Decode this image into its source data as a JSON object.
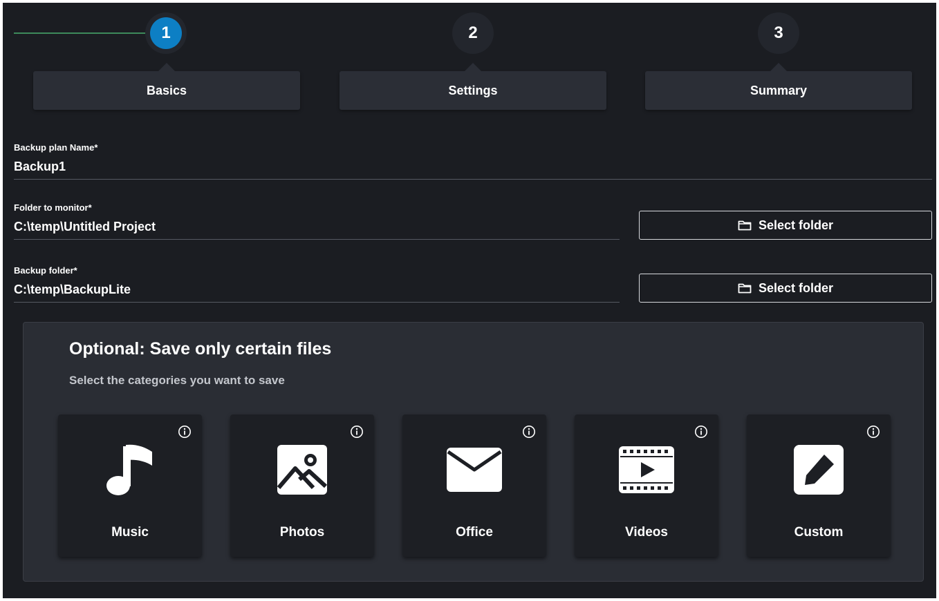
{
  "stepper": {
    "steps": [
      {
        "number": "1",
        "label": "Basics",
        "state": "active"
      },
      {
        "number": "2",
        "label": "Settings",
        "state": "inactive"
      },
      {
        "number": "3",
        "label": "Summary",
        "state": "inactive"
      }
    ],
    "active_color": "#0d7fc4",
    "progress_line_color": "#3e8a5b"
  },
  "form": {
    "plan_name": {
      "label": "Backup plan Name*",
      "value": "Backup1"
    },
    "folder_to_monitor": {
      "label": "Folder to monitor*",
      "value": "C:\\temp\\Untitled Project",
      "button_label": "Select folder",
      "button_icon": "folder-icon"
    },
    "backup_folder": {
      "label": "Backup folder*",
      "value": "C:\\temp\\BackupLite",
      "button_label": "Select folder",
      "button_icon": "folder-icon"
    }
  },
  "optional": {
    "title": "Optional: Save only certain files",
    "subtitle": "Select the categories you want to save",
    "categories": [
      {
        "label": "Music",
        "icon": "music-note-icon"
      },
      {
        "label": "Photos",
        "icon": "image-icon"
      },
      {
        "label": "Office",
        "icon": "envelope-icon"
      },
      {
        "label": "Videos",
        "icon": "film-play-icon"
      },
      {
        "label": "Custom",
        "icon": "pencil-icon"
      }
    ],
    "info_icon": "info-icon"
  },
  "colors": {
    "background": "#1b1d22",
    "card": "#2b2e36",
    "panel": "#2a2d34"
  }
}
